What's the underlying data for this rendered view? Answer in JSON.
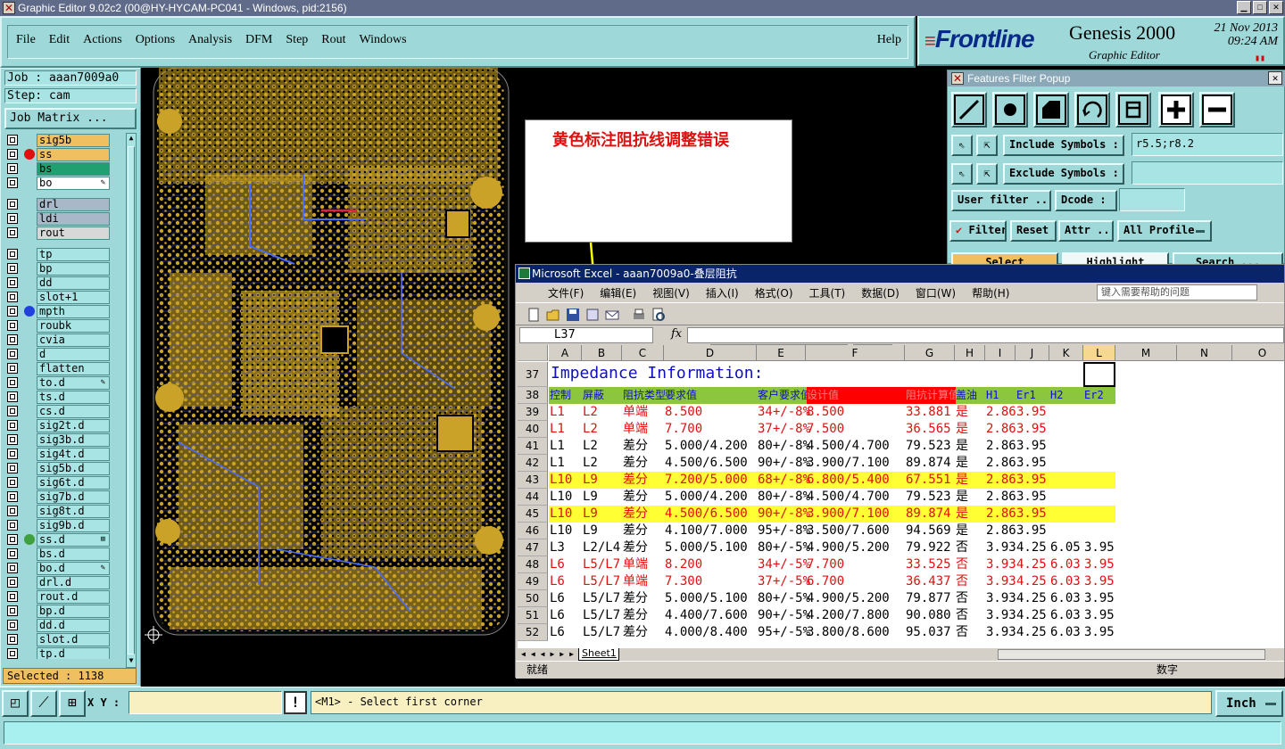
{
  "window": {
    "title": "Graphic Editor 9.02c2 (00@HY-HYCAM-PC041 - Windows, pid:2156)"
  },
  "menu": {
    "items": [
      "File",
      "Edit",
      "Actions",
      "Options",
      "Analysis",
      "DFM",
      "Step",
      "Rout",
      "Windows"
    ],
    "help": "Help"
  },
  "logo": {
    "brand": "Frontline",
    "product": "Genesis 2000",
    "subtitle": "Graphic Editor",
    "date": "21 Nov 2013",
    "time": "09:24 AM"
  },
  "job": {
    "job_label": "Job : aaan7009a0",
    "step_label": "Step: cam",
    "matrix_button": "Job Matrix ..."
  },
  "layers": [
    {
      "name": "sig5b",
      "color": "#f0c060",
      "dot": "",
      "flag": ""
    },
    {
      "name": "ss",
      "color": "#f0c060",
      "dot": "#e01010",
      "flag": ""
    },
    {
      "name": "bs",
      "color": "#20a070",
      "dot": "",
      "flag": ""
    },
    {
      "name": "bo",
      "color": "#ffffff",
      "dot": "",
      "flag": "✎"
    },
    {
      "sep": true
    },
    {
      "name": "drl",
      "color": "#a8b8c8",
      "dot": "",
      "flag": ""
    },
    {
      "name": "ldi",
      "color": "#a8b8c8",
      "dot": "",
      "flag": ""
    },
    {
      "name": "rout",
      "color": "#d8d8d8",
      "dot": "",
      "flag": ""
    },
    {
      "sep": true
    },
    {
      "name": "tp",
      "color": "#a8e4e4",
      "dot": "",
      "flag": ""
    },
    {
      "name": "bp",
      "color": "#a8e4e4",
      "dot": "",
      "flag": ""
    },
    {
      "name": "dd",
      "color": "#a8e4e4",
      "dot": "",
      "flag": ""
    },
    {
      "name": "slot+1",
      "color": "#a8e4e4",
      "dot": "",
      "flag": ""
    },
    {
      "name": "mpth",
      "color": "#a8e4e4",
      "dot": "#2040e0",
      "flag": ""
    },
    {
      "name": "roubk",
      "color": "#a8e4e4",
      "dot": "",
      "flag": ""
    },
    {
      "name": "cvia",
      "color": "#a8e4e4",
      "dot": "",
      "flag": ""
    },
    {
      "name": "d",
      "color": "#a8e4e4",
      "dot": "",
      "flag": ""
    },
    {
      "name": "flatten",
      "color": "#a8e4e4",
      "dot": "",
      "flag": ""
    },
    {
      "name": "to.d",
      "color": "#a8e4e4",
      "dot": "",
      "flag": "✎"
    },
    {
      "name": "ts.d",
      "color": "#a8e4e4",
      "dot": "",
      "flag": ""
    },
    {
      "name": "cs.d",
      "color": "#a8e4e4",
      "dot": "",
      "flag": ""
    },
    {
      "name": "sig2t.d",
      "color": "#a8e4e4",
      "dot": "",
      "flag": ""
    },
    {
      "name": "sig3b.d",
      "color": "#a8e4e4",
      "dot": "",
      "flag": ""
    },
    {
      "name": "sig4t.d",
      "color": "#a8e4e4",
      "dot": "",
      "flag": ""
    },
    {
      "name": "sig5b.d",
      "color": "#a8e4e4",
      "dot": "",
      "flag": ""
    },
    {
      "name": "sig6t.d",
      "color": "#a8e4e4",
      "dot": "",
      "flag": ""
    },
    {
      "name": "sig7b.d",
      "color": "#a8e4e4",
      "dot": "",
      "flag": ""
    },
    {
      "name": "sig8t.d",
      "color": "#a8e4e4",
      "dot": "",
      "flag": ""
    },
    {
      "name": "sig9b.d",
      "color": "#a8e4e4",
      "dot": "",
      "flag": ""
    },
    {
      "name": "ss.d",
      "color": "#a8e4e4",
      "dot": "#40a040",
      "flag": "⊞"
    },
    {
      "name": "bs.d",
      "color": "#a8e4e4",
      "dot": "",
      "flag": ""
    },
    {
      "name": "bo.d",
      "color": "#a8e4e4",
      "dot": "",
      "flag": "✎"
    },
    {
      "name": "drl.d",
      "color": "#a8e4e4",
      "dot": "",
      "flag": ""
    },
    {
      "name": "rout.d",
      "color": "#a8e4e4",
      "dot": "",
      "flag": ""
    },
    {
      "name": "bp.d",
      "color": "#a8e4e4",
      "dot": "",
      "flag": ""
    },
    {
      "name": "dd.d",
      "color": "#a8e4e4",
      "dot": "",
      "flag": ""
    },
    {
      "name": "slot.d",
      "color": "#a8e4e4",
      "dot": "",
      "flag": ""
    },
    {
      "name": "tp.d",
      "color": "#a8e4e4",
      "dot": "",
      "flag": ""
    }
  ],
  "selected": "Selected : 1138",
  "annotation": {
    "text": "黄色标注阻抗线调整错误"
  },
  "filter_popup": {
    "title": "Features Filter Popup",
    "include_label": "Include Symbols :",
    "include_value": "r5.5;r8.2",
    "exclude_label": "Exclude Symbols :",
    "exclude_value": "",
    "user_filter": "User filter ...",
    "dcode": "Dcode :",
    "dcode_value": "",
    "filter": "Filter",
    "reset": "Reset",
    "attr": "Attr ...",
    "all_profile": "All Profile",
    "select": "Select",
    "highlight": "Highlight",
    "search": "Search ..."
  },
  "excel": {
    "title": "Microsoft Excel - aaan7009a0-叠层阻抗",
    "menus": [
      "文件(F)",
      "编辑(E)",
      "视图(V)",
      "插入(I)",
      "格式(O)",
      "工具(T)",
      "数据(D)",
      "窗口(W)",
      "帮助(H)"
    ],
    "help_placeholder": "键入需要帮助的问题",
    "font": "宋体",
    "font_size": "12",
    "name_box": "L37",
    "fx": "fx",
    "sheet": "Sheet1",
    "status_left": "就绪",
    "status_right": "数字",
    "columns": [
      "A",
      "B",
      "C",
      "D",
      "E",
      "F",
      "G",
      "H",
      "I",
      "J",
      "K",
      "L",
      "M",
      "N",
      "O"
    ],
    "title_row": {
      "num": "37",
      "text": "Impedance Information:"
    },
    "header_row": {
      "num": "38",
      "cells": [
        "控制",
        "屏蔽",
        "阻抗类型",
        "要求值",
        "客户要求值",
        "设计值",
        "阻抗计算值",
        "盖油",
        "H1",
        "Er1",
        "H2",
        "Er2"
      ]
    },
    "rows": [
      {
        "num": "39",
        "style": "red",
        "cells": [
          "L1",
          "L2",
          "单端",
          "8.500",
          "34+/-8%",
          "8.500",
          "33.881",
          "是",
          "2.86",
          "3.95",
          "",
          ""
        ]
      },
      {
        "num": "40",
        "style": "red",
        "cells": [
          "L1",
          "L2",
          "单端",
          "7.700",
          "37+/-8%",
          "7.500",
          "36.565",
          "是",
          "2.86",
          "3.95",
          "",
          ""
        ]
      },
      {
        "num": "41",
        "style": "black",
        "cells": [
          "L1",
          "L2",
          "差分",
          "5.000/4.200",
          "80+/-8%",
          "4.500/4.700",
          "79.523",
          "是",
          "2.86",
          "3.95",
          "",
          ""
        ]
      },
      {
        "num": "42",
        "style": "black",
        "cells": [
          "L1",
          "L2",
          "差分",
          "4.500/6.500",
          "90+/-8%",
          "3.900/7.100",
          "89.874",
          "是",
          "2.86",
          "3.95",
          "",
          ""
        ]
      },
      {
        "num": "43",
        "style": "yellow",
        "cells": [
          "L10",
          "L9",
          "差分",
          "7.200/5.000",
          "68+/-8%",
          "6.800/5.400",
          "67.551",
          "是",
          "2.86",
          "3.95",
          "",
          ""
        ]
      },
      {
        "num": "44",
        "style": "black",
        "cells": [
          "L10",
          "L9",
          "差分",
          "5.000/4.200",
          "80+/-8%",
          "4.500/4.700",
          "79.523",
          "是",
          "2.86",
          "3.95",
          "",
          ""
        ]
      },
      {
        "num": "45",
        "style": "yellow",
        "cells": [
          "L10",
          "L9",
          "差分",
          "4.500/6.500",
          "90+/-8%",
          "3.900/7.100",
          "89.874",
          "是",
          "2.86",
          "3.95",
          "",
          ""
        ]
      },
      {
        "num": "46",
        "style": "black",
        "cells": [
          "L10",
          "L9",
          "差分",
          "4.100/7.000",
          "95+/-8%",
          "3.500/7.600",
          "94.569",
          "是",
          "2.86",
          "3.95",
          "",
          ""
        ]
      },
      {
        "num": "47",
        "style": "black",
        "cells": [
          "L3",
          "L2/L4",
          "差分",
          "5.000/5.100",
          "80+/-5%",
          "4.900/5.200",
          "79.922",
          "否",
          "3.93",
          "4.25",
          "6.05",
          "3.95"
        ]
      },
      {
        "num": "48",
        "style": "red",
        "cells": [
          "L6",
          "L5/L7",
          "单端",
          "8.200",
          "34+/-5%",
          "7.700",
          "33.525",
          "否",
          "3.93",
          "4.25",
          "6.03",
          "3.95"
        ]
      },
      {
        "num": "49",
        "style": "red",
        "cells": [
          "L6",
          "L5/L7",
          "单端",
          "7.300",
          "37+/-5%",
          "6.700",
          "36.437",
          "否",
          "3.93",
          "4.25",
          "6.03",
          "3.95"
        ]
      },
      {
        "num": "50",
        "style": "black",
        "cells": [
          "L6",
          "L5/L7",
          "差分",
          "5.000/5.100",
          "80+/-5%",
          "4.900/5.200",
          "79.877",
          "否",
          "3.93",
          "4.25",
          "6.03",
          "3.95"
        ]
      },
      {
        "num": "51",
        "style": "black",
        "cells": [
          "L6",
          "L5/L7",
          "差分",
          "4.400/7.600",
          "90+/-5%",
          "4.200/7.800",
          "90.080",
          "否",
          "3.93",
          "4.25",
          "6.03",
          "3.95"
        ]
      },
      {
        "num": "52",
        "style": "black",
        "cells": [
          "L6",
          "L5/L7",
          "差分",
          "4.000/8.400",
          "95+/-5%",
          "3.800/8.600",
          "95.037",
          "否",
          "3.93",
          "4.25",
          "6.03",
          "3.95"
        ]
      }
    ],
    "colors": {
      "yellow_row": "#ffff33",
      "header_bg": "#8cc63f",
      "red_text": "#e01010",
      "blue_text": "#1010c0"
    }
  },
  "bottom": {
    "xy_label": "X Y :",
    "xy_value": "",
    "prompt": "<M1> - Select first corner",
    "units": "Inch"
  }
}
